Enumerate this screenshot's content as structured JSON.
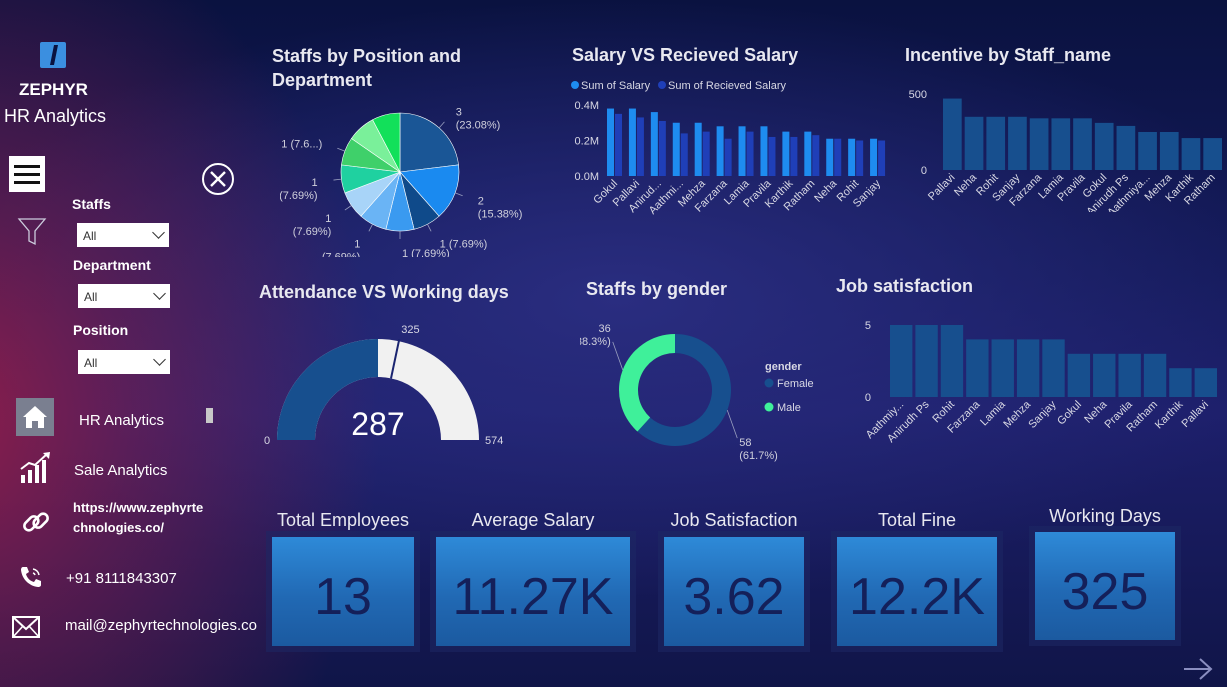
{
  "sidebar": {
    "brand": "ZEPHYR",
    "subtitle": "HR Analytics",
    "filters": [
      {
        "label": "Staffs",
        "value": "All"
      },
      {
        "label": "Department",
        "value": "All"
      },
      {
        "label": "Position",
        "value": "All"
      }
    ],
    "nav": [
      {
        "label": "HR Analytics",
        "icon": "home-icon"
      },
      {
        "label": "Sale Analytics",
        "icon": "growth-chart-icon"
      }
    ],
    "website_line1": "https://www.zephyrte",
    "website_line2": "chnologies.co/",
    "phone": "+91 8111843307",
    "email": "mail@zephyrtechnologies.co"
  },
  "charts": {
    "pie_title": "Staffs by Position and Department",
    "salary_title": "Salary VS Recieved Salary",
    "incentive_title": "Incentive by Staff_name",
    "gauge_title": "Attendance VS Working days",
    "gender_title": "Staffs by gender",
    "jobsat_title": "Job satisfaction"
  },
  "chart_data": [
    {
      "type": "pie",
      "title": "Staffs by Position and Department",
      "values": [
        3,
        2,
        1,
        1,
        1,
        1,
        1,
        1,
        1,
        1
      ],
      "labels": [
        "3\n(23.08%)",
        "2\n(15.38%)",
        "1 (7.69%)",
        "1 (7.69%)",
        "1\n(7.69%)",
        "1\n(7.69%)",
        "1\n(7.69%)",
        "1 (7.6...)",
        "",
        ""
      ],
      "colors": [
        "#1a5696",
        "#1a8af0",
        "#0f4a8a",
        "#3a9af0",
        "#6ab4f5",
        "#a8d4f8",
        "#1fd1a0",
        "#3fd06a",
        "#7af09a",
        "#12e05a"
      ]
    },
    {
      "type": "bar",
      "title": "Salary VS Recieved Salary",
      "categories": [
        "Gokul",
        "Pallavi",
        "Anirud...",
        "Aathmi...",
        "Mehza",
        "Farzana",
        "Lamia",
        "Pravila",
        "Karthik",
        "Ratham",
        "Neha",
        "Rohit",
        "Sanjay"
      ],
      "series": [
        {
          "name": "Sum of Salary",
          "color": "#1e8cf0",
          "values": [
            0.38,
            0.38,
            0.36,
            0.3,
            0.3,
            0.28,
            0.28,
            0.28,
            0.25,
            0.25,
            0.21,
            0.21,
            0.21
          ]
        },
        {
          "name": "Sum of Recieved Salary",
          "color": "#1f3fb8",
          "values": [
            0.35,
            0.33,
            0.31,
            0.24,
            0.25,
            0.21,
            0.25,
            0.22,
            0.22,
            0.23,
            0.21,
            0.2,
            0.2
          ]
        }
      ],
      "yticks": [
        "0.0M",
        "0.2M",
        "0.4M"
      ],
      "ylim": [
        0,
        0.4
      ]
    },
    {
      "type": "bar",
      "title": "Incentive by Staff_name",
      "categories": [
        "Pallavi",
        "Neha",
        "Rohit",
        "Sanjay",
        "Farzana",
        "Lamia",
        "Pravila",
        "Gokul",
        "Anirudh Ps",
        "Aathmiya...",
        "Mehza",
        "Karthik",
        "Ratham"
      ],
      "values": [
        470,
        350,
        350,
        350,
        340,
        340,
        340,
        310,
        290,
        250,
        250,
        210,
        210
      ],
      "yticks": [
        "0",
        "500"
      ],
      "ylim": [
        0,
        500
      ],
      "color": "#174f8e"
    },
    {
      "type": "gauge",
      "title": "Attendance VS Working days",
      "value": 287,
      "target": 325,
      "min": 0,
      "max": 574,
      "value_label": "287",
      "target_label": "325",
      "min_label": "0",
      "max_label": "574"
    },
    {
      "type": "pie",
      "title": "Staffs by gender",
      "legend_title": "gender",
      "series": [
        {
          "name": "Female",
          "value": 58,
          "label": "58\n(61.7%)",
          "color": "#174f8e"
        },
        {
          "name": "Male",
          "value": 36,
          "label": "36\n(38.3%)",
          "color": "#3ff09a"
        }
      ]
    },
    {
      "type": "bar",
      "title": "Job satisfaction",
      "categories": [
        "Aathmiy...",
        "Anirudh Ps",
        "Rohit",
        "Farzana",
        "Lamia",
        "Mehza",
        "Sanjay",
        "Gokul",
        "Neha",
        "Pravila",
        "Ratham",
        "Karthik",
        "Pallavi"
      ],
      "values": [
        5,
        5,
        5,
        4,
        4,
        4,
        4,
        3,
        3,
        3,
        3,
        2,
        2
      ],
      "yticks": [
        "0",
        "5"
      ],
      "ylim": [
        0,
        5
      ],
      "color": "#174f8e"
    }
  ],
  "kpis": [
    {
      "title": "Total Employees",
      "value": "13"
    },
    {
      "title": "Average Salary",
      "value": "11.27K"
    },
    {
      "title": "Job Satisfaction",
      "value": "3.62"
    },
    {
      "title": "Total Fine",
      "value": "12.2K"
    },
    {
      "title": "Working Days",
      "value": "325"
    }
  ]
}
